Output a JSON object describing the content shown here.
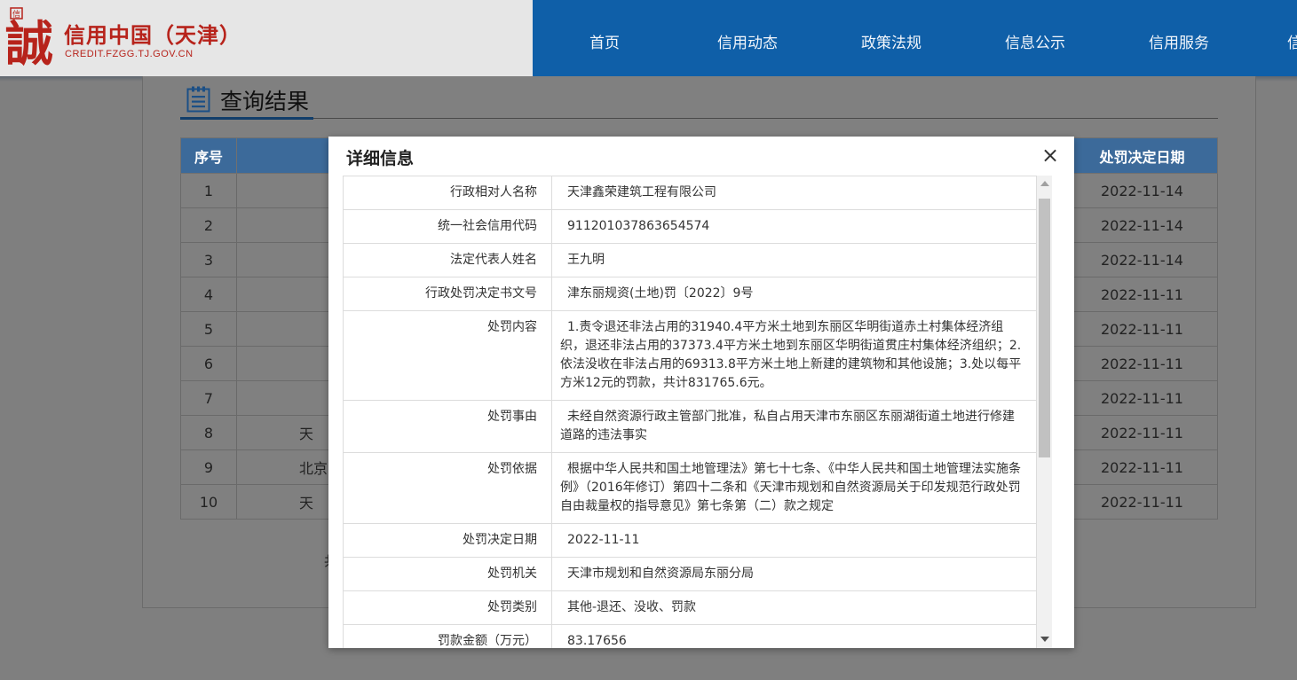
{
  "header": {
    "logo_icon": "credit-seal-icon",
    "logo_seal_char": "信",
    "logo_big_char": "誠",
    "site_title": "信用中国（天津）",
    "site_url": "CREDIT.FZGG.TJ.GOV.CN",
    "nav": [
      "首页",
      "信用动态",
      "政策法规",
      "信息公示",
      "信用服务",
      "信"
    ]
  },
  "results": {
    "title": "查询结果",
    "icon": "clipboard-list-icon",
    "columns": {
      "index": "序号",
      "date": "处罚决定日期"
    },
    "rows": [
      {
        "index": "1",
        "name": "",
        "date": "2022-11-14"
      },
      {
        "index": "2",
        "name": "",
        "date": "2022-11-14"
      },
      {
        "index": "3",
        "name": "",
        "date": "2022-11-14"
      },
      {
        "index": "4",
        "name": "",
        "date": "2022-11-11"
      },
      {
        "index": "5",
        "name": "",
        "date": "2022-11-11"
      },
      {
        "index": "6",
        "name": "",
        "date": "2022-11-11"
      },
      {
        "index": "7",
        "name": "",
        "date": "2022-11-11"
      },
      {
        "index": "8",
        "name": "天",
        "date": "2022-11-11"
      },
      {
        "index": "9",
        "name": "北京",
        "date": "2022-11-11"
      },
      {
        "index": "10",
        "name": "天",
        "date": "2022-11-11"
      }
    ],
    "pager_fragment": "共"
  },
  "modal": {
    "title": "详细信息",
    "close_glyph": "×",
    "fields": [
      {
        "label": "行政相对人名称",
        "value": "天津鑫荣建筑工程有限公司"
      },
      {
        "label": "统一社会信用代码",
        "value": "911201037863654574"
      },
      {
        "label": "法定代表人姓名",
        "value": "王九明"
      },
      {
        "label": "行政处罚决定书文号",
        "value": "津东丽规资(土地)罚〔2022〕9号"
      },
      {
        "label": "处罚内容",
        "value": "1.责令退还非法占用的31940.4平方米土地到东丽区华明街道赤土村集体经济组织，退还非法占用的37373.4平方米土地到东丽区华明街道贯庄村集体经济组织；2.依法没收在非法占用的69313.8平方米土地上新建的建筑物和其他设施；3.处以每平方米12元的罚款，共计831765.6元。"
      },
      {
        "label": "处罚事由",
        "value": "未经自然资源行政主管部门批准，私自占用天津市东丽区东丽湖街道土地进行修建道路的违法事实"
      },
      {
        "label": "处罚依据",
        "value": "根据中华人民共和国土地管理法》第七十七条、《中华人民共和国土地管理法实施条例》（2016年修订）第四十二条和《天津市规划和自然资源局关于印发规范行政处罚自由裁量权的指导意见》第七条第（二）款之规定"
      },
      {
        "label": "处罚决定日期",
        "value": "2022-11-11"
      },
      {
        "label": "处罚机关",
        "value": "天津市规划和自然资源局东丽分局"
      },
      {
        "label": "处罚类别",
        "value": "其他-退还、没收、罚款"
      },
      {
        "label": "罚款金额（万元）",
        "value": "83.17656"
      }
    ]
  },
  "colors": {
    "nav_blue": "#0f5fa8",
    "brand_red": "#b7231b",
    "table_header": "#3c6a9a",
    "overlay": "#7f7f7f"
  }
}
